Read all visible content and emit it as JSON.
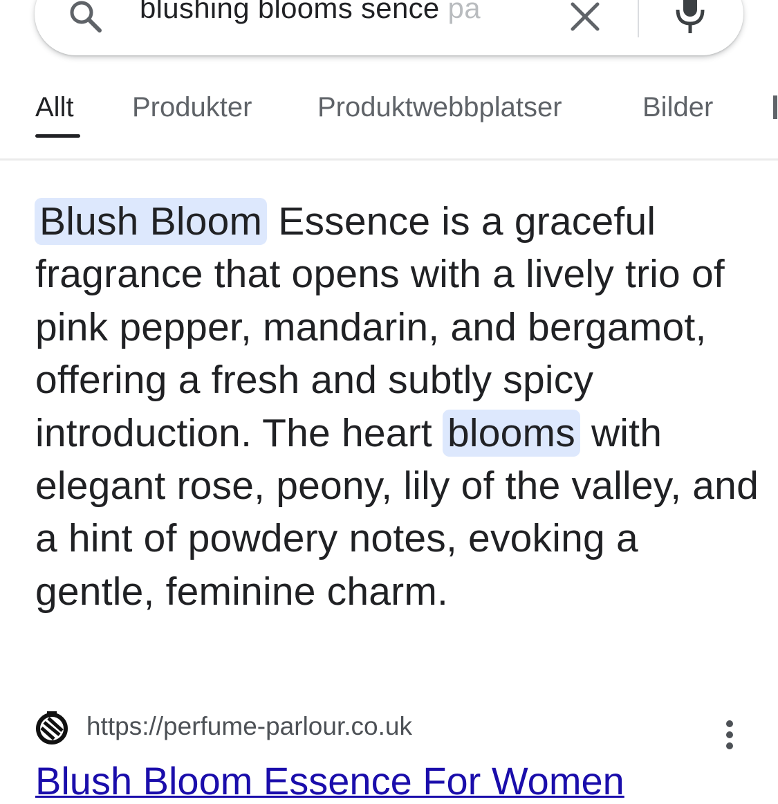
{
  "search": {
    "query_main": "blushing blooms sence ",
    "query_faded": "pa",
    "clear_icon": "close-icon",
    "search_icon": "search-icon",
    "mic_icon": "microphone-icon"
  },
  "tabs": [
    {
      "label": "Allt",
      "active": true
    },
    {
      "label": "Produkter",
      "active": false
    },
    {
      "label": "Produktwebbplatser",
      "active": false
    },
    {
      "label": "Bilder",
      "active": false
    }
  ],
  "snippet": {
    "highlight_1": "Blush Bloom",
    "text_1": " Essence is a graceful fragrance that opens with a lively trio of pink pepper, mandarin, and bergamot, offering a fresh and subtly spicy introduction. The heart ",
    "highlight_2": "blooms",
    "text_2": " with elegant rose, peony, lily of the valley, and a hint of powdery notes, evoking a gentle, feminine charm."
  },
  "source": {
    "url": "https://perfume-parlour.co.uk",
    "title": "Blush Bloom Essence For Women",
    "icon": "site-logo-icon",
    "menu_icon": "more-vertical-icon"
  },
  "colors": {
    "highlight": "#dde8fd",
    "link": "#1a0dab",
    "text": "#202124",
    "muted": "#5f6368"
  }
}
